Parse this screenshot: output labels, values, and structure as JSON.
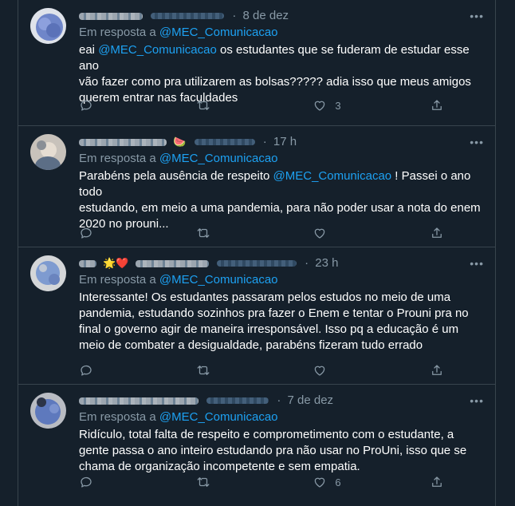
{
  "tweets": [
    {
      "time": "8 de dez",
      "reply_prefix": "Em resposta a",
      "reply_to": "@MEC_Comunicacao",
      "text_lines": [
        [
          {
            "t": "eai "
          },
          {
            "t": "@MEC_Comunicacao",
            "m": true
          },
          {
            "t": " os estudantes que se fuderam de estudar esse ano"
          }
        ],
        [
          {
            "t": "vão fazer como pra utilizarem as bolsas????? adia isso que meus amigos"
          }
        ],
        [
          {
            "t": "querem entrar nas faculdades"
          }
        ]
      ],
      "reply_count": "",
      "retweet_count": "",
      "like_count": "3",
      "emoji": ""
    },
    {
      "time": "17 h",
      "reply_prefix": "Em resposta a",
      "reply_to": "@MEC_Comunicacao",
      "text_lines": [
        [
          {
            "t": "Parabéns pela ausência de respeito "
          },
          {
            "t": "@MEC_Comunicacao",
            "m": true
          },
          {
            "t": " ! Passei o ano todo"
          }
        ],
        [
          {
            "t": "estudando, em meio a uma pandemia, para não poder usar a nota do enem"
          }
        ],
        [
          {
            "t": "2020 no prouni..."
          }
        ]
      ],
      "reply_count": "",
      "retweet_count": "",
      "like_count": "",
      "emoji": "🍉"
    },
    {
      "time": "23 h",
      "reply_prefix": "Em resposta a",
      "reply_to": "@MEC_Comunicacao",
      "text_lines": [
        [
          {
            "t": "Interessante! Os estudantes passaram pelos estudos no meio de uma"
          }
        ],
        [
          {
            "t": "pandemia, estudando sozinhos pra fazer o Enem e tentar o Prouni pra no"
          }
        ],
        [
          {
            "t": "final o governo agir de maneira irresponsável. Isso pq a educação é um"
          }
        ],
        [
          {
            "t": "meio de combater a desigualdade, parabéns fizeram tudo errado"
          }
        ]
      ],
      "reply_count": "",
      "retweet_count": "",
      "like_count": "",
      "emoji": "🌟❤️"
    },
    {
      "time": "7 de dez",
      "reply_prefix": "Em resposta a",
      "reply_to": "@MEC_Comunicacao",
      "text_lines": [
        [
          {
            "t": "Ridículo, total falta de respeito e comprometimento com o estudante, a"
          }
        ],
        [
          {
            "t": "gente passa o ano inteiro estudando pra não usar no ProUni, isso que se"
          }
        ],
        [
          {
            "t": "chama de organização incompetente e sem empatia."
          }
        ]
      ],
      "reply_count": "",
      "retweet_count": "",
      "like_count": "6",
      "emoji": ""
    }
  ],
  "icons": {
    "reply": "speech-bubble-icon",
    "retweet": "retweet-icon",
    "like": "heart-icon",
    "share": "share-icon",
    "more": "more-dots-icon"
  },
  "colors": {
    "background": "#15202b",
    "border": "#38444d",
    "muted": "#8899a6",
    "accent": "#1da1f2",
    "text": "#ffffff"
  }
}
